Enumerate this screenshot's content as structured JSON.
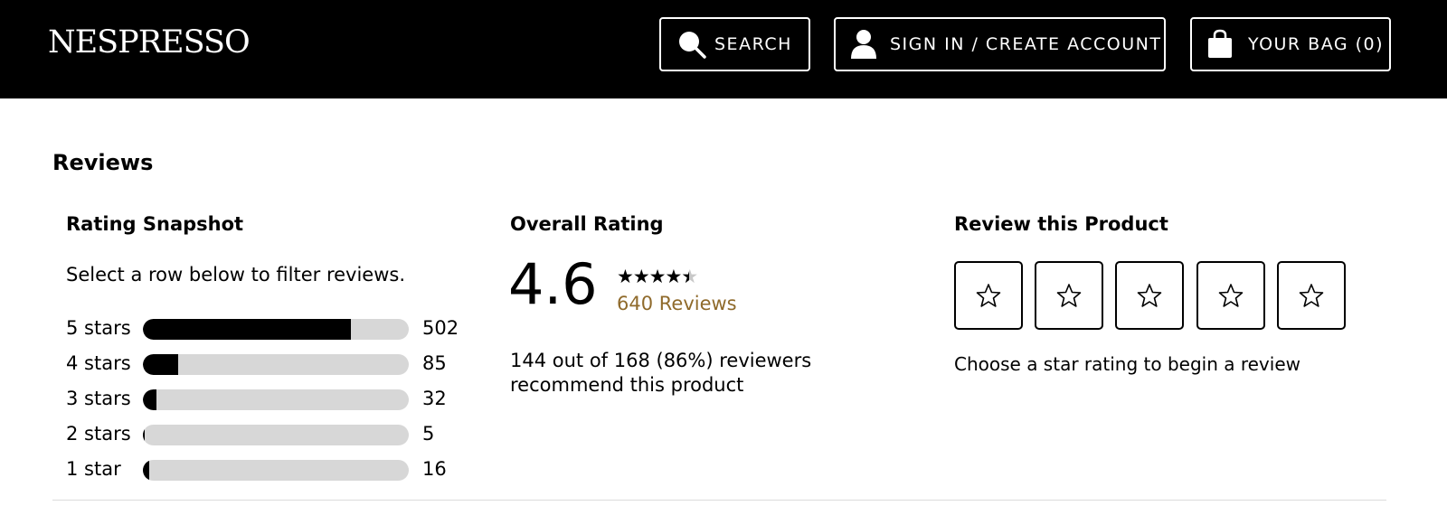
{
  "header": {
    "logo": "NESPRESSO",
    "search_label": "SEARCH",
    "signin_label": "SIGN IN / CREATE ACCOUNT",
    "bag_label": "YOUR BAG (0)"
  },
  "reviews": {
    "title": "Reviews",
    "snapshot": {
      "heading": "Rating Snapshot",
      "instruction": "Select a row below to filter reviews.",
      "rows": [
        {
          "label": "5 stars",
          "count": "502",
          "fraction": 0.784
        },
        {
          "label": "4 stars",
          "count": "85",
          "fraction": 0.133
        },
        {
          "label": "3 stars",
          "count": "32",
          "fraction": 0.05
        },
        {
          "label": "2 stars",
          "count": "5",
          "fraction": 0.008
        },
        {
          "label": "1 star",
          "count": "16",
          "fraction": 0.025
        }
      ]
    },
    "overall": {
      "heading": "Overall Rating",
      "score": "4.6",
      "stars_value": 4.6,
      "reviews_link": "640 Reviews",
      "recommend_text": "144 out of 168 (86%) reviewers recommend this product"
    },
    "write": {
      "heading": "Review this Product",
      "help_text": "Choose a star rating to begin a review",
      "star_count": 5
    }
  },
  "colors": {
    "header_bg": "#000000",
    "bar_fill": "#000000",
    "bar_track": "#d7d7d7",
    "link": "#8f6a2b"
  },
  "icons": [
    "search-icon",
    "user-icon",
    "bag-icon",
    "star-icon"
  ]
}
